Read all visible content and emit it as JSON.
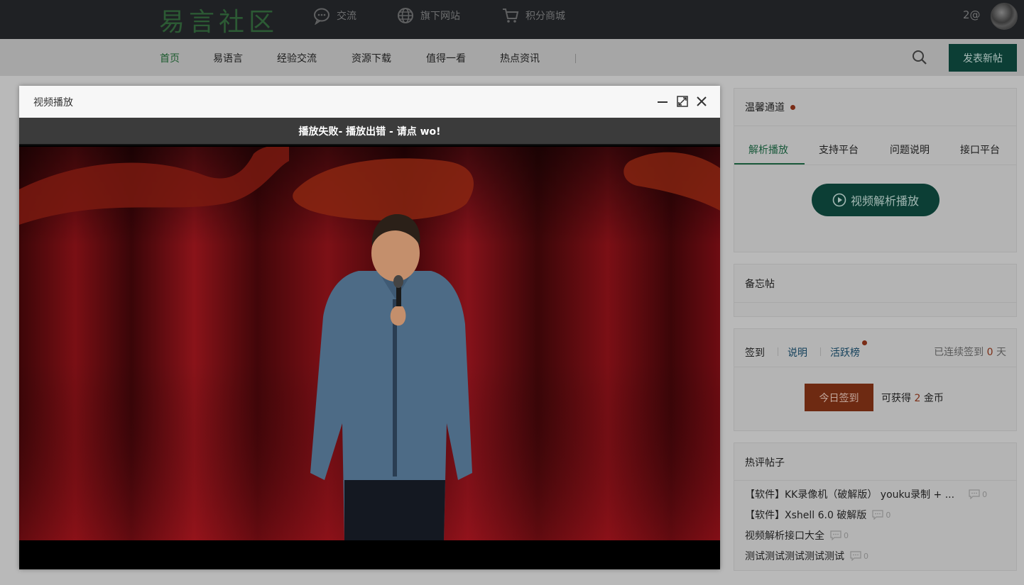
{
  "topbar": {
    "logo": "易言社区",
    "links": [
      {
        "label": "交流",
        "icon": "chat-bubble-icon"
      },
      {
        "label": "旗下网站",
        "icon": "globe-icon"
      },
      {
        "label": "积分商城",
        "icon": "cart-icon"
      }
    ],
    "user_name": "2@"
  },
  "nav": {
    "items": [
      "首页",
      "易语言",
      "经验交流",
      "资源下载",
      "值得一看",
      "热点资讯"
    ],
    "active_index": 0,
    "post_button": "发表新帖",
    "search_icon": "search-icon"
  },
  "sidebar": {
    "notice": {
      "title": "温馨通道",
      "tabs": [
        "解析播放",
        "支持平台",
        "问题说明",
        "接口平台"
      ],
      "active_tab": 0,
      "parse_button": "视频解析播放"
    },
    "memo": {
      "title": "备忘帖"
    },
    "signin": {
      "tabs": [
        "签到",
        "说明",
        "活跃榜"
      ],
      "status_prefix": "已连续签到",
      "streak_days": "0",
      "status_suffix": "天",
      "button": "今日签到",
      "gain_prefix": "可获得",
      "gain_amount": "2",
      "gain_suffix": "金币"
    },
    "hot": {
      "title": "热评帖子",
      "items": [
        {
          "title": "【软件】KK录像机（破解版） youku录制 + ...",
          "comments": "0"
        },
        {
          "title": "【软件】Xshell 6.0 破解版",
          "comments": "0"
        },
        {
          "title": "视频解析接口大全",
          "comments": "0"
        },
        {
          "title": "测试测试测试测试测试",
          "comments": "0"
        }
      ]
    }
  },
  "modal": {
    "title": "视频播放",
    "status_text": "播放失败- 播放出错 - 请点 wo!",
    "controls": [
      "minimize-icon",
      "maximize-icon",
      "close-icon"
    ]
  },
  "colors": {
    "topbar_bg": "#1f2124",
    "accent_green": "#0c3e35",
    "accent_orange": "#6e2a12"
  }
}
